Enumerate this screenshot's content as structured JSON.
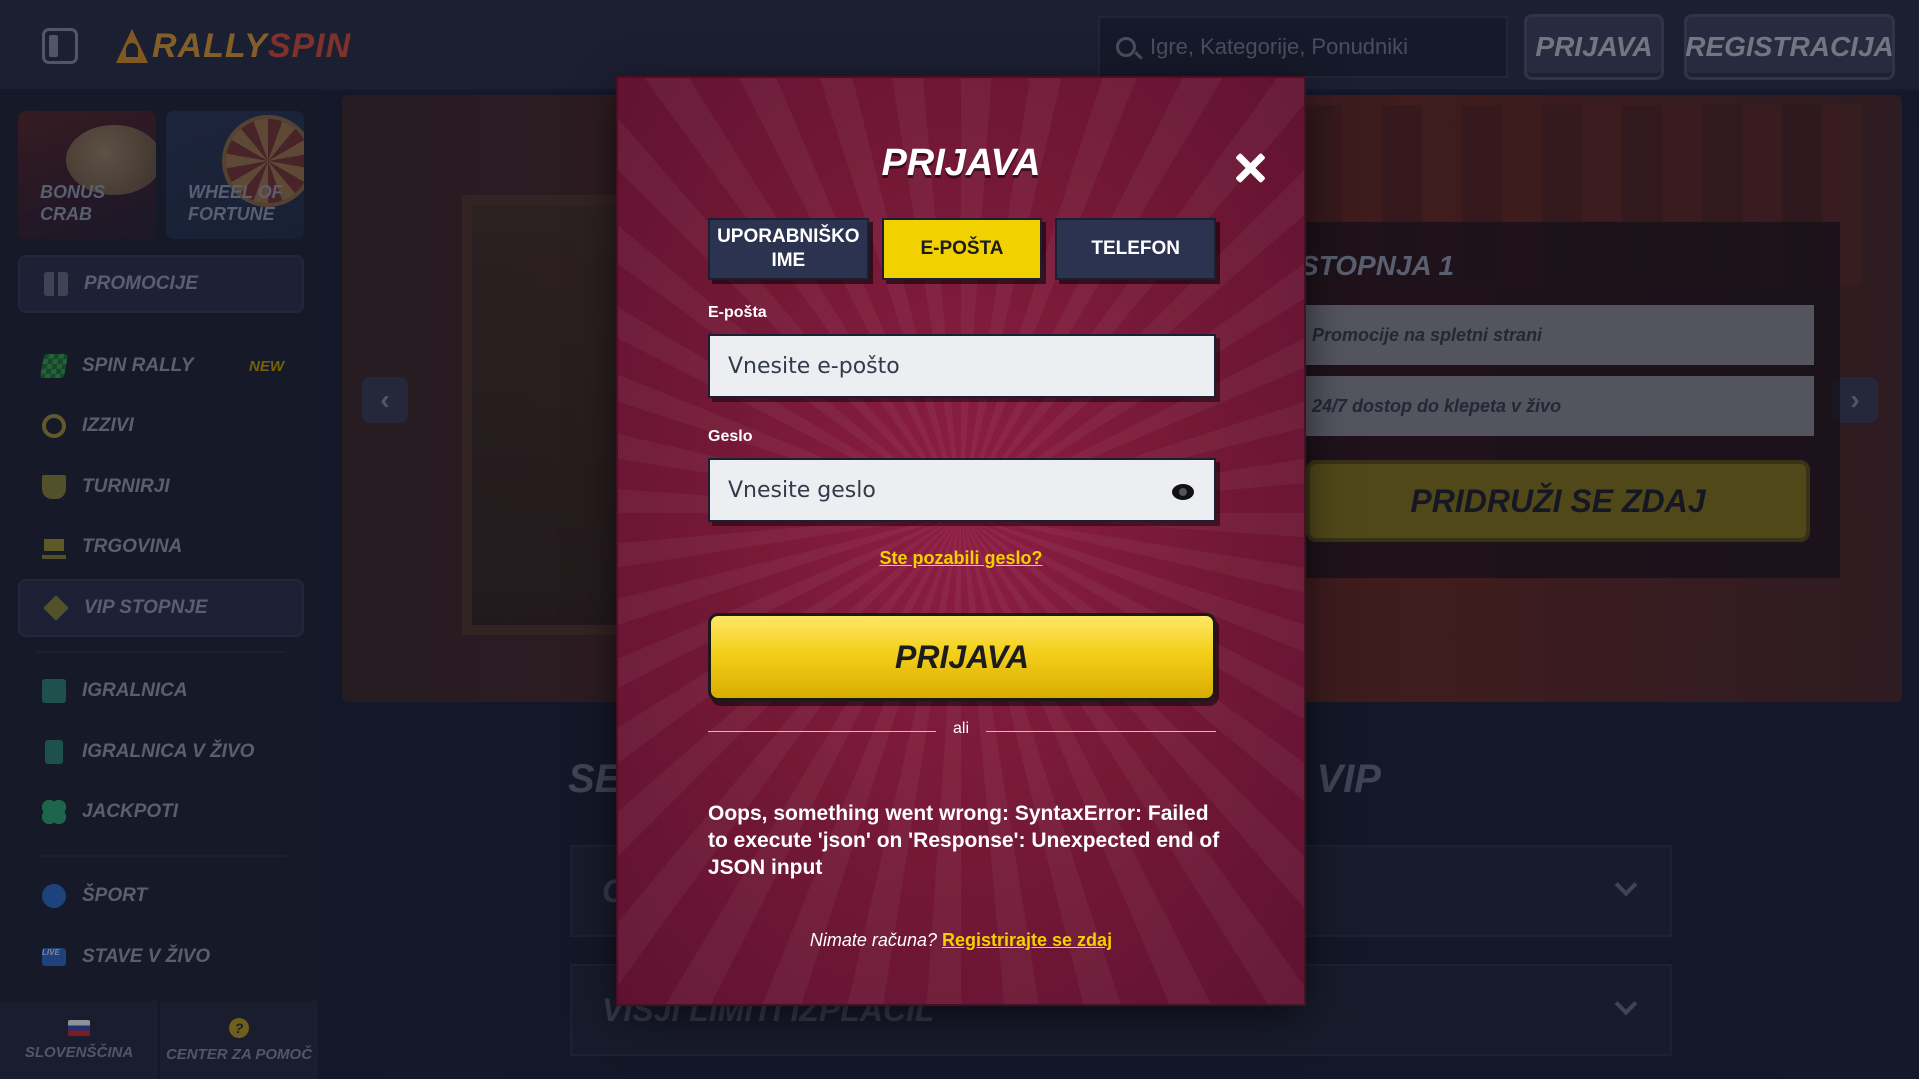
{
  "header": {
    "logo_text_a": "RALLY",
    "logo_text_b": "SPIN",
    "search_placeholder": "Igre, Kategorije, Ponudniki",
    "login_label": "PRIJAVA",
    "register_label": "REGISTRACIJA"
  },
  "sidebar": {
    "promo_cards": [
      {
        "label": "BONUS\nCRAB"
      },
      {
        "label": "WHEEL OF\nFORTUNE"
      }
    ],
    "items": [
      {
        "label": "PROMOCIJE",
        "icon": "gift-icon"
      },
      {
        "label": "SPIN RALLY",
        "icon": "race-flag-icon",
        "badge": "NEW"
      },
      {
        "label": "IZZIVI",
        "icon": "medal-icon"
      },
      {
        "label": "TURNIRJI",
        "icon": "trophy-icon"
      },
      {
        "label": "TRGOVINA",
        "icon": "cart-icon"
      },
      {
        "label": "VIP STOPNJE",
        "icon": "diamond-icon"
      },
      {
        "label": "IGRALNICA",
        "icon": "slot-machine-icon"
      },
      {
        "label": "IGRALNICA V ŽIVO",
        "icon": "playing-card-icon"
      },
      {
        "label": "JACKPOTI",
        "icon": "clover-icon"
      },
      {
        "label": "ŠPORT",
        "icon": "football-icon"
      },
      {
        "label": "STAVE V ŽIVO",
        "icon": "live-tv-icon",
        "icon_text": "LIVE"
      }
    ],
    "bottom": {
      "language_label": "SLOVENŠČINA",
      "help_label": "CENTER ZA POMOČ",
      "help_glyph": "?"
    }
  },
  "main": {
    "vip_title": "STOPNJA 1",
    "vip_rows": [
      "Promocije na spletni strani",
      "24/7 dostop do klepeta v živo"
    ],
    "join_label": "PRIDRUŽI SE ZDAJ",
    "section_title_left": "SE",
    "section_title_right": "A VIP",
    "accordion": [
      {
        "label": "C"
      },
      {
        "label": "VIŠJI LIMITI IZPLAČIL"
      }
    ]
  },
  "modal": {
    "title": "PRIJAVA",
    "tabs": [
      {
        "label": "UPORABNIŠKO IME",
        "active": false
      },
      {
        "label": "E-POŠTA",
        "active": true
      },
      {
        "label": "TELEFON",
        "active": false
      }
    ],
    "email_label": "E-pošta",
    "email_placeholder": "Vnesite e-pošto",
    "password_label": "Geslo",
    "password_placeholder": "Vnesite geslo",
    "forgot_link": "Ste pozabili geslo?",
    "submit_label": "PRIJAVA",
    "divider_text": "ali",
    "error_message": "Oops, something went wrong: SyntaxError: Failed to execute 'json' on 'Response': Unexpected end of JSON input",
    "signup_question": "Nimate računa?",
    "signup_link": "Registrirajte se zdaj"
  },
  "colors": {
    "accent_yellow": "#f2d100",
    "modal_red": "#741836",
    "background": "#1c2236"
  }
}
